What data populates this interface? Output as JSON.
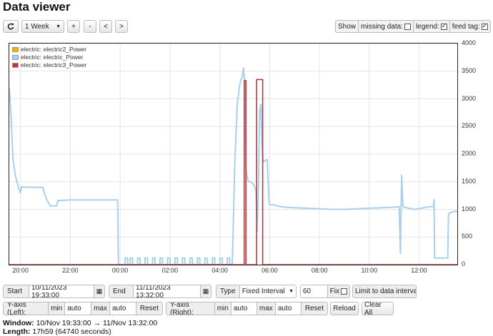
{
  "page": {
    "title": "Data viewer"
  },
  "toolbar": {
    "refresh_icon": "refresh-icon",
    "range_value": "1 Week",
    "zoom_in": "+",
    "zoom_out": "-",
    "pan_left": "<",
    "pan_right": ">",
    "show_label": "Show",
    "missing_data_label": "missing data:",
    "missing_data_checked": false,
    "legend_label": "legend:",
    "legend_checked": true,
    "feed_tag_label": "feed tag:",
    "feed_tag_checked": true
  },
  "legend": [
    {
      "label": "electric: electric2_Power",
      "color": "#f0b400"
    },
    {
      "label": "electric: electric_Power",
      "color": "#a9d0ea"
    },
    {
      "label": "electric: electric3_Power",
      "color": "#c8303a"
    }
  ],
  "chart_data": {
    "type": "line",
    "x_tick_labels": [
      "20:00",
      "22:00",
      "00:00",
      "02:00",
      "04:00",
      "06:00",
      "08:00",
      "10:00",
      "12:00"
    ],
    "y_right_tick_labels": [
      "0",
      "500",
      "1000",
      "1500",
      "2000",
      "2500",
      "3000",
      "3500",
      "4000"
    ],
    "ylim_right": [
      0,
      4000
    ],
    "xlim_hours": [
      19.55,
      37.533
    ],
    "grid": true,
    "legend_position": "top-left",
    "series": [
      {
        "name": "electric: electric_Power",
        "color": "#a9d0ea",
        "points": [
          [
            19.55,
            3200
          ],
          [
            19.62,
            2700
          ],
          [
            19.7,
            1900
          ],
          [
            19.8,
            1600
          ],
          [
            19.9,
            1420
          ],
          [
            20.0,
            1300
          ],
          [
            20.05,
            1410
          ],
          [
            20.3,
            1400
          ],
          [
            20.6,
            1400
          ],
          [
            20.9,
            1400
          ],
          [
            20.95,
            1300
          ],
          [
            21.05,
            1180
          ],
          [
            21.2,
            1060
          ],
          [
            21.45,
            1060
          ],
          [
            21.5,
            1160
          ],
          [
            22.0,
            1170
          ],
          [
            22.5,
            1170
          ],
          [
            23.0,
            1170
          ],
          [
            23.5,
            1170
          ],
          [
            23.9,
            1170
          ],
          [
            23.93,
            0
          ],
          [
            24.2,
            0
          ],
          [
            24.2,
            120
          ],
          [
            24.3,
            120
          ],
          [
            24.3,
            0
          ],
          [
            24.4,
            0
          ],
          [
            24.4,
            120
          ],
          [
            24.5,
            120
          ],
          [
            24.5,
            0
          ],
          [
            24.7,
            0
          ],
          [
            24.7,
            120
          ],
          [
            24.8,
            120
          ],
          [
            24.8,
            0
          ],
          [
            25.0,
            0
          ],
          [
            25.0,
            120
          ],
          [
            25.1,
            120
          ],
          [
            25.1,
            0
          ],
          [
            25.3,
            0
          ],
          [
            25.3,
            120
          ],
          [
            25.4,
            120
          ],
          [
            25.4,
            0
          ],
          [
            25.6,
            0
          ],
          [
            25.6,
            120
          ],
          [
            25.7,
            120
          ],
          [
            25.7,
            0
          ],
          [
            25.9,
            0
          ],
          [
            25.9,
            120
          ],
          [
            26.0,
            120
          ],
          [
            26.0,
            0
          ],
          [
            26.2,
            0
          ],
          [
            26.2,
            120
          ],
          [
            26.3,
            120
          ],
          [
            26.3,
            0
          ],
          [
            26.5,
            0
          ],
          [
            26.5,
            120
          ],
          [
            26.6,
            120
          ],
          [
            26.6,
            0
          ],
          [
            26.8,
            0
          ],
          [
            26.8,
            120
          ],
          [
            26.9,
            120
          ],
          [
            26.9,
            0
          ],
          [
            27.1,
            0
          ],
          [
            27.1,
            120
          ],
          [
            27.2,
            120
          ],
          [
            27.2,
            0
          ],
          [
            27.4,
            0
          ],
          [
            27.4,
            120
          ],
          [
            27.5,
            120
          ],
          [
            27.5,
            0
          ],
          [
            27.7,
            0
          ],
          [
            27.7,
            120
          ],
          [
            27.8,
            120
          ],
          [
            27.8,
            0
          ],
          [
            28.0,
            0
          ],
          [
            28.0,
            120
          ],
          [
            28.1,
            120
          ],
          [
            28.1,
            0
          ],
          [
            28.3,
            0
          ],
          [
            28.3,
            120
          ],
          [
            28.4,
            120
          ],
          [
            28.4,
            0
          ],
          [
            28.5,
            0
          ],
          [
            28.6,
            1800
          ],
          [
            28.7,
            2900
          ],
          [
            28.8,
            3250
          ],
          [
            28.85,
            3350
          ],
          [
            28.9,
            3400
          ],
          [
            28.95,
            3560
          ],
          [
            29.0,
            3300
          ],
          [
            29.05,
            1700
          ],
          [
            29.15,
            1500
          ],
          [
            29.25,
            1500
          ],
          [
            29.35,
            1450
          ],
          [
            29.45,
            1350
          ],
          [
            29.5,
            600
          ],
          [
            29.55,
            1350
          ],
          [
            29.6,
            2800
          ],
          [
            29.65,
            2900
          ],
          [
            29.7,
            2100
          ],
          [
            29.75,
            1850
          ],
          [
            29.8,
            1880
          ],
          [
            29.9,
            1900
          ],
          [
            29.98,
            1100
          ],
          [
            30.05,
            1080
          ],
          [
            30.2,
            1080
          ],
          [
            30.3,
            1060
          ],
          [
            30.6,
            1040
          ],
          [
            31.0,
            1030
          ],
          [
            31.5,
            1020
          ],
          [
            32.0,
            1010
          ],
          [
            32.5,
            1000
          ],
          [
            33.0,
            1000
          ],
          [
            33.5,
            1010
          ],
          [
            34.0,
            1020
          ],
          [
            34.5,
            1030
          ],
          [
            35.0,
            1040
          ],
          [
            35.2,
            1050
          ],
          [
            35.25,
            200
          ],
          [
            35.3,
            1620
          ],
          [
            35.35,
            1050
          ],
          [
            35.5,
            1030
          ],
          [
            35.8,
            1000
          ],
          [
            36.0,
            1010
          ],
          [
            36.3,
            1040
          ],
          [
            36.5,
            1050
          ],
          [
            36.58,
            1050
          ],
          [
            36.6,
            1180
          ],
          [
            36.62,
            120
          ],
          [
            36.8,
            120
          ],
          [
            37.0,
            120
          ],
          [
            37.15,
            120
          ],
          [
            37.18,
            920
          ],
          [
            37.3,
            950
          ],
          [
            37.45,
            970
          ],
          [
            37.533,
            960
          ]
        ]
      },
      {
        "name": "electric: electric3_Power",
        "color": "#c8303a",
        "points": [
          [
            19.55,
            0
          ],
          [
            28.98,
            0
          ],
          [
            28.98,
            3330
          ],
          [
            29.05,
            3330
          ],
          [
            29.05,
            0
          ],
          [
            29.48,
            0
          ],
          [
            29.48,
            3350
          ],
          [
            29.72,
            3350
          ],
          [
            29.72,
            0
          ],
          [
            37.533,
            0
          ]
        ]
      }
    ]
  },
  "controls": {
    "start_label": "Start",
    "start_value": "10/11/2023 19:33:00",
    "end_label": "End",
    "end_value": "11/11/2023 13:32:00",
    "type_label": "Type",
    "type_value": "Fixed Interval",
    "interval_value": "60",
    "fix_label": "Fix",
    "fix_checked": false,
    "limit_label": "Limit to data interval",
    "limit_checked": true,
    "yleft_label": "Y-axis (Left):",
    "yleft_min_label": "min",
    "yleft_min_value": "auto",
    "yleft_max_label": "max",
    "yleft_max_value": "auto",
    "yleft_reset": "Reset",
    "yright_label": "Y-axis (Right):",
    "yright_min_label": "min",
    "yright_min_value": "auto",
    "yright_max_label": "max",
    "yright_max_value": "auto",
    "yright_reset": "Reset",
    "reload": "Reload",
    "clear_all": "Clear All"
  },
  "status": {
    "window_label": "Window:",
    "window_value": "10/Nov 19:33:00 → 11/Nov 13:32:00",
    "length_label": "Length:",
    "length_value": "17h59 (64740 seconds)"
  }
}
